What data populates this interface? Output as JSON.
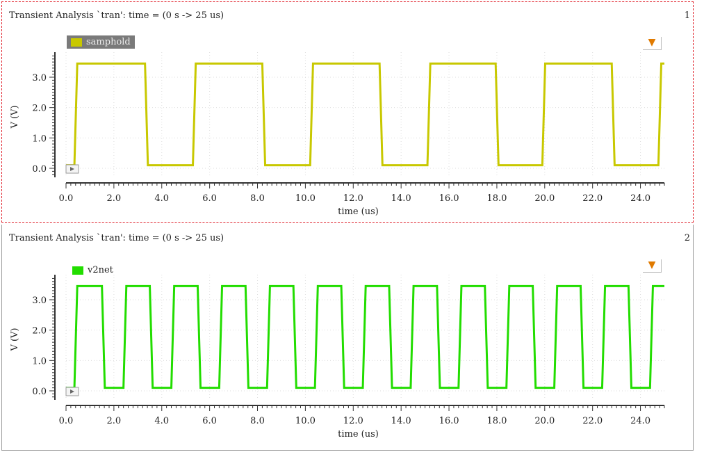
{
  "chart_data": [
    {
      "type": "line",
      "title": "Transient Analysis `tran': time = (0 s -> 25 us)",
      "panel_number": "1",
      "xlabel": "time (us)",
      "ylabel": "V (V)",
      "xlim": [
        0,
        25
      ],
      "ylim": [
        -0.3,
        3.8
      ],
      "xticks": [
        "0.0",
        "2.0",
        "4.0",
        "6.0",
        "8.0",
        "10.0",
        "12.0",
        "14.0",
        "16.0",
        "18.0",
        "20.0",
        "22.0",
        "24.0"
      ],
      "yticks": [
        "0.0",
        "1.0",
        "2.0",
        "3.0"
      ],
      "grid": true,
      "series": [
        {
          "name": "samphold",
          "color": "#c8c800",
          "low": 0.1,
          "high": 3.45,
          "rise": [
            0.35,
            5.3,
            10.2,
            15.1,
            19.9,
            24.75
          ],
          "fall": [
            3.3,
            8.2,
            13.1,
            17.95,
            22.8
          ]
        }
      ]
    },
    {
      "type": "line",
      "title": "Transient Analysis `tran': time = (0 s -> 25 us)",
      "panel_number": "2",
      "xlabel": "time (us)",
      "ylabel": "V (V)",
      "xlim": [
        0,
        25
      ],
      "ylim": [
        -0.3,
        3.8
      ],
      "xticks": [
        "0.0",
        "2.0",
        "4.0",
        "6.0",
        "8.0",
        "10.0",
        "12.0",
        "14.0",
        "16.0",
        "18.0",
        "20.0",
        "22.0",
        "24.0"
      ],
      "yticks": [
        "0.0",
        "1.0",
        "2.0",
        "3.0"
      ],
      "grid": true,
      "series": [
        {
          "name": "v2net",
          "color": "#22dd00",
          "low": 0.1,
          "high": 3.45,
          "rise": [
            0.35,
            2.4,
            4.4,
            6.4,
            8.4,
            10.4,
            12.4,
            14.4,
            16.4,
            18.4,
            20.4,
            22.4,
            24.4
          ],
          "fall": [
            1.5,
            3.5,
            5.5,
            7.5,
            9.5,
            11.5,
            13.5,
            15.5,
            17.5,
            19.5,
            21.5,
            23.5
          ]
        }
      ]
    }
  ],
  "colors": {
    "selected_border": "#e0202a",
    "filter_icon": "#e07a00"
  }
}
